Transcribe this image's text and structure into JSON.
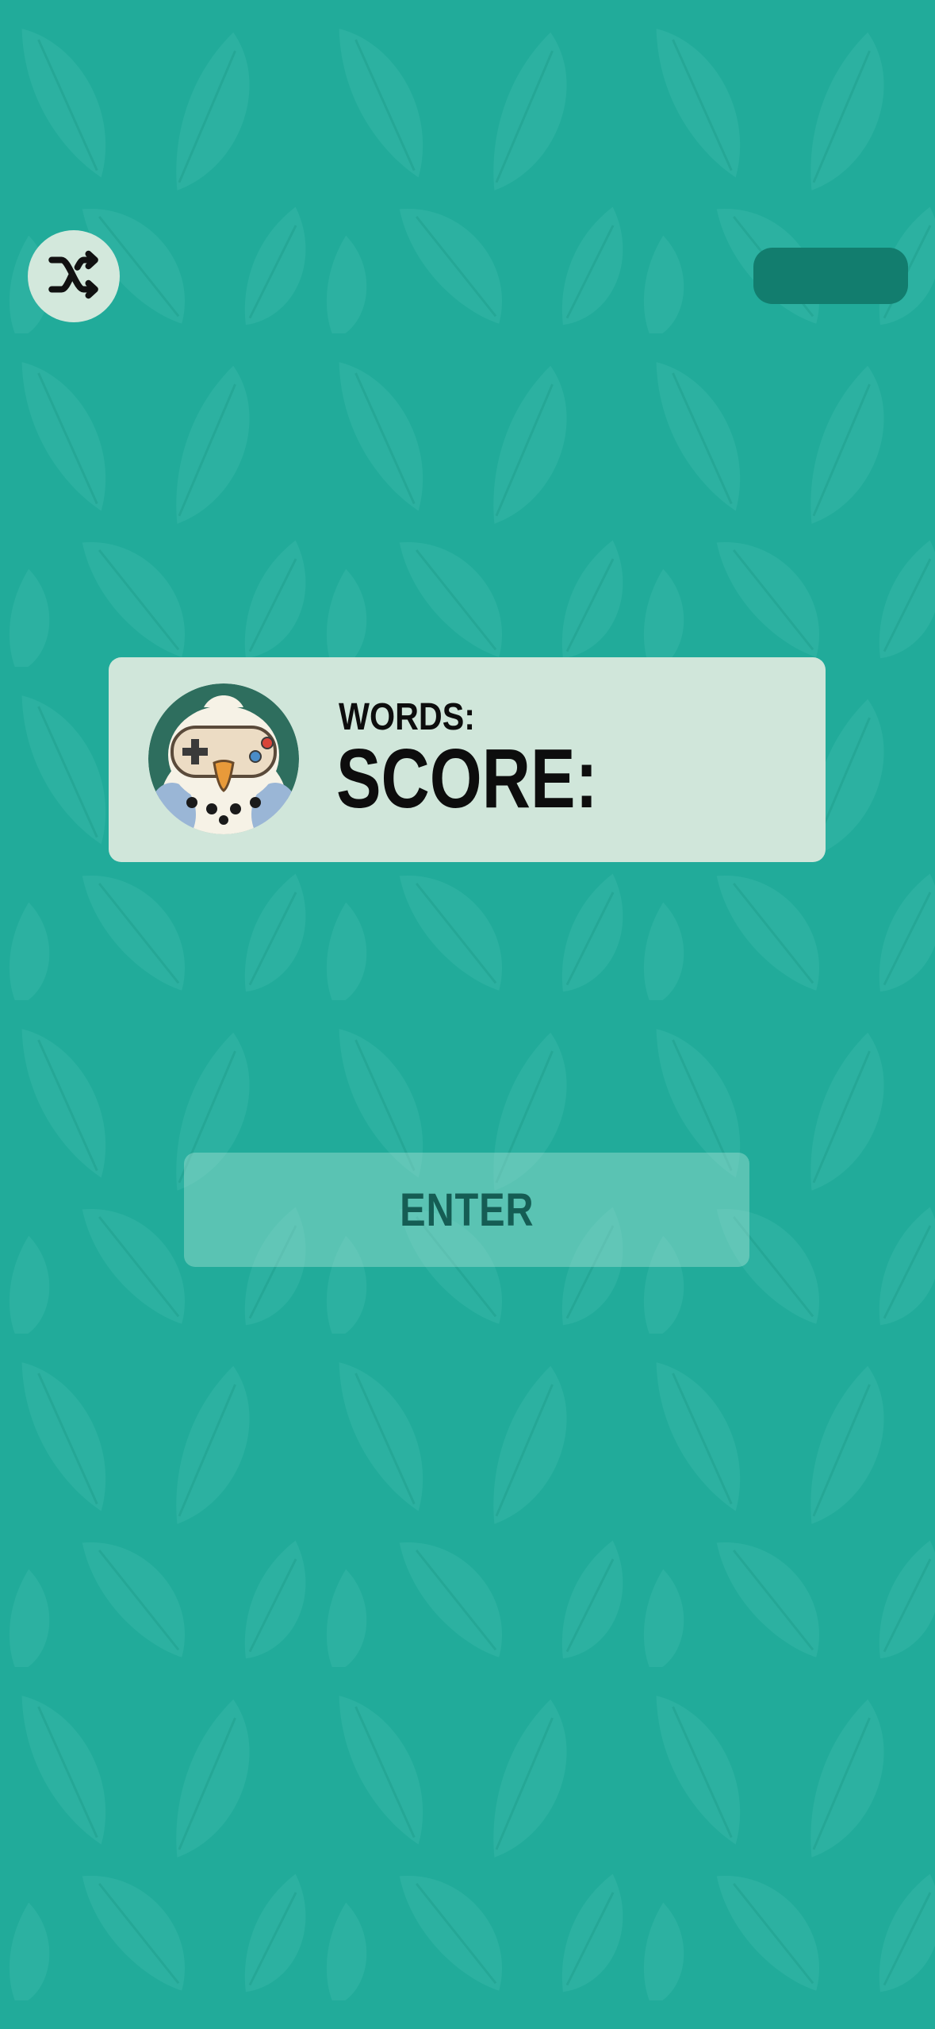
{
  "controls": {
    "shuffle_icon": "shuffle-icon"
  },
  "score_card": {
    "avatar_icon": "budgie-gamepad-avatar",
    "words_label": "WORDS:",
    "score_label": "SCORE:"
  },
  "enter_button": {
    "label": "ENTER"
  },
  "colors": {
    "background": "#21ab9a",
    "pattern_leaf": "#2fb6a5",
    "card": "#d0e6da",
    "pill": "#127d6e",
    "enter_text": "#155d54"
  }
}
